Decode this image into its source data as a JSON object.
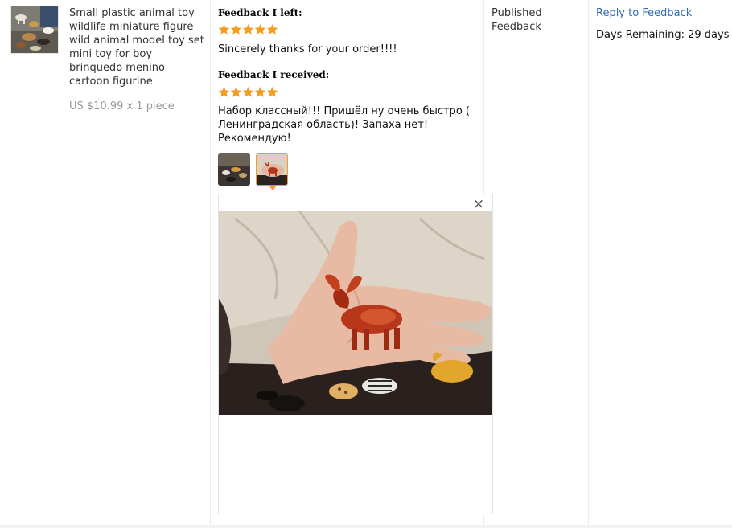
{
  "product": {
    "thumbnail_icon": "animal-figures-photo",
    "title": "Small plastic animal toy wildlife miniature figure wild animal model toy set mini toy for boy brinquedo menino cartoon figurine",
    "price": "US $10.99 x 1 piece"
  },
  "feedback_left": {
    "heading": "Feedback I left:",
    "rating": 5,
    "text": "Sincerely thanks for your order!!!!"
  },
  "feedback_received": {
    "heading": "Feedback I received:",
    "rating": 5,
    "text": "Набор классный!!! Пришёл ну очень быстро ( Ленинградская область)! Запаха нет! Рекомендую!",
    "photos": [
      {
        "icon": "animal-figures-photo",
        "active": false
      },
      {
        "icon": "moose-figure-photo",
        "active": true
      }
    ],
    "preview": {
      "close_glyph": "×",
      "image_icon": "hand-holding-moose-figure-photo"
    }
  },
  "status": {
    "label": "Published Feedback"
  },
  "actions": {
    "reply_label": "Reply to Feedback",
    "days_remaining": "Days Remaining: 29 days"
  },
  "colors": {
    "star": "#f39c1f",
    "link": "#2f6db3",
    "price": "#999999",
    "active_border": "#f39c1f"
  }
}
